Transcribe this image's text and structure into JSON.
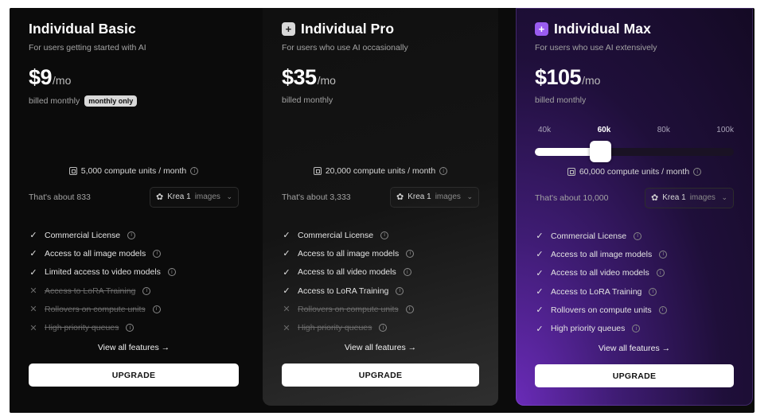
{
  "plans": [
    {
      "key": "basic",
      "name": "Individual Basic",
      "icon": "",
      "subtitle": "For users getting started with AI",
      "price": "$9",
      "per": "/mo",
      "billed": "billed monthly",
      "badge": "monthly only",
      "compute": "5,000 compute units / month",
      "about": "That's about 833",
      "model": "Krea 1",
      "model_unit": "images",
      "features": [
        {
          "label": "Commercial License",
          "included": true
        },
        {
          "label": "Access to all image models",
          "included": true
        },
        {
          "label": "Limited access to video models",
          "included": true
        },
        {
          "label": "Access to LoRA Training",
          "included": false
        },
        {
          "label": "Rollovers on compute units",
          "included": false
        },
        {
          "label": "High priority queues",
          "included": false
        }
      ],
      "view_all": "View all features →",
      "cta": "UPGRADE"
    },
    {
      "key": "pro",
      "name": "Individual Pro",
      "icon": "plus-square-icon",
      "subtitle": "For users who use AI occasionally",
      "price": "$35",
      "per": "/mo",
      "billed": "billed monthly",
      "compute": "20,000 compute units / month",
      "about": "That's about 3,333",
      "model": "Krea 1",
      "model_unit": "images",
      "features": [
        {
          "label": "Commercial License",
          "included": true
        },
        {
          "label": "Access to all image models",
          "included": true
        },
        {
          "label": "Access to all video models",
          "included": true
        },
        {
          "label": "Access to LoRA Training",
          "included": true
        },
        {
          "label": "Rollovers on compute units",
          "included": false
        },
        {
          "label": "High priority queues",
          "included": false
        }
      ],
      "view_all": "View all features →",
      "cta": "UPGRADE"
    },
    {
      "key": "max",
      "name": "Individual Max",
      "icon": "plus-square-icon",
      "subtitle": "For users who use AI extensively",
      "price": "$105",
      "per": "/mo",
      "billed": "billed monthly",
      "slider": {
        "ticks": [
          "40k",
          "60k",
          "80k",
          "100k"
        ],
        "selected": "60k",
        "level": 0.33
      },
      "compute": "60,000 compute units / month",
      "about": "That's about 10,000",
      "model": "Krea 1",
      "model_unit": "images",
      "features": [
        {
          "label": "Commercial License",
          "included": true
        },
        {
          "label": "Access to all image models",
          "included": true
        },
        {
          "label": "Access to all video models",
          "included": true
        },
        {
          "label": "Access to LoRA Training",
          "included": true
        },
        {
          "label": "Rollovers on compute units",
          "included": true
        },
        {
          "label": "High priority queues",
          "included": true
        }
      ],
      "view_all": "View all features →",
      "cta": "UPGRADE"
    }
  ],
  "colors": {
    "background": "#0b0b0b",
    "max_accent": "#6a2bb8",
    "icon_purple": "#9a5cf0",
    "muted_text": "#a3a3a3",
    "disabled_text": "#6a6a6a"
  }
}
